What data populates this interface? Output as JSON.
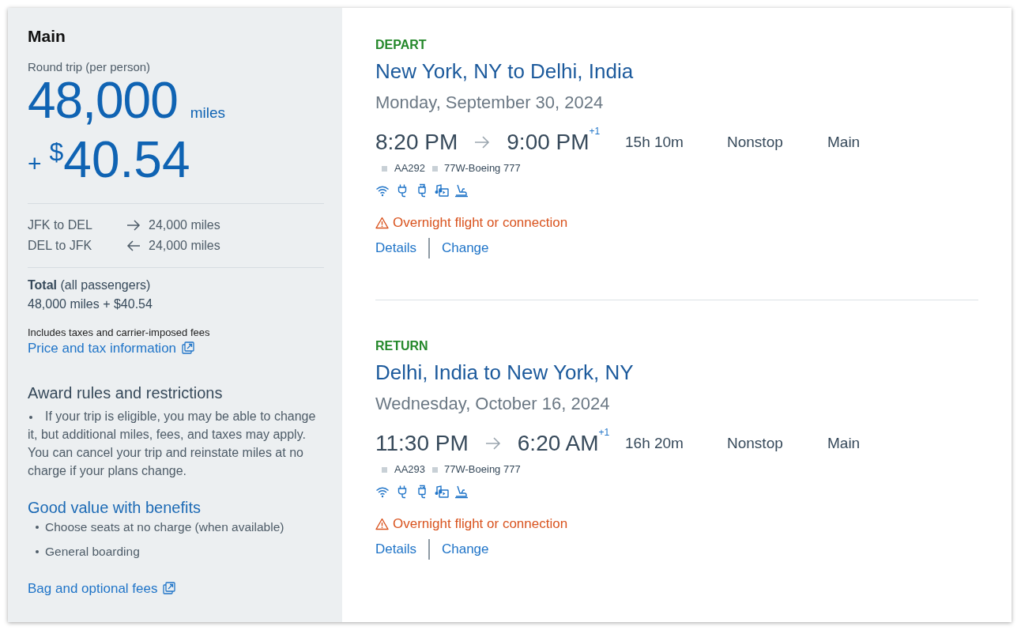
{
  "fare_summary": {
    "cabin": "Main",
    "trip_type": "Round trip (per person)",
    "price": {
      "miles": "48,000",
      "miles_unit": "miles",
      "plus": "+",
      "currency": "$",
      "cash": "40.54"
    },
    "segments": [
      {
        "route": "JFK to DEL",
        "kind": "outbound",
        "miles": "24,000 miles"
      },
      {
        "route": "DEL to JFK",
        "kind": "return",
        "miles": "24,000 miles"
      }
    ],
    "total": {
      "label": "**Total** (all passengers)",
      "amount": "48,000 miles + $40.54"
    },
    "fees_note": "Includes taxes and carrier-imposed fees",
    "price_link": "Price and tax information",
    "award_rules": {
      "title": "Award rules and restrictions",
      "items": [
        "If your trip is eligible, you may be able to change it, but additional miles, fees, and taxes may apply. You can cancel your trip and reinstate miles at no charge if your plans change."
      ]
    },
    "benefits": {
      "title": "Good value with benefits",
      "items": [
        "Choose seats at no charge (when available)",
        "General boarding"
      ]
    },
    "bag_link": "Bag and optional fees"
  },
  "flights": [
    {
      "label": "DEPART",
      "route": "New York, NY to Delhi, India",
      "date": "Monday, September 30, 2024",
      "depart_time": "8:20 PM",
      "arrive_time": "9:00 PM",
      "day_offset": "+1",
      "duration": "15h 10m",
      "stops": "Nonstop",
      "cabin": "Main",
      "flight_number": "AA292",
      "aircraft": "77W-Boeing 777",
      "alert": "Overnight flight or connection",
      "links": [
        "Details",
        "Change"
      ]
    },
    {
      "label": "RETURN",
      "route": "Delhi, India to New York, NY",
      "date": "Wednesday, October 16, 2024",
      "depart_time": "11:30 PM",
      "arrive_time": "6:20 AM",
      "day_offset": "+1",
      "duration": "16h 20m",
      "stops": "Nonstop",
      "cabin": "Main",
      "flight_number": "AA293",
      "aircraft": "77W-Boeing 777",
      "alert": "Overnight flight or connection",
      "links": [
        "Details",
        "Change"
      ]
    }
  ]
}
